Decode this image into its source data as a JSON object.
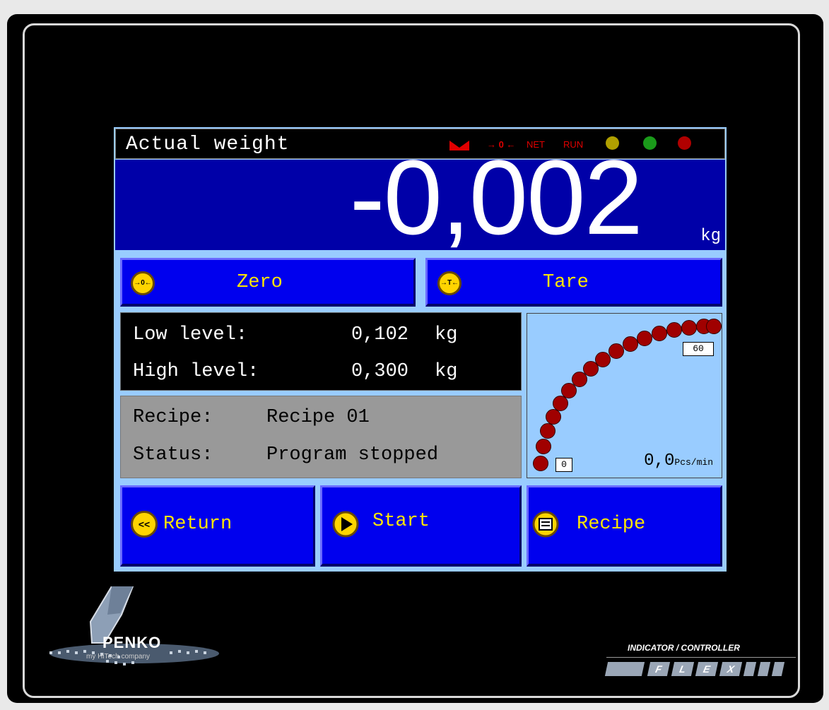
{
  "header": {
    "title": "Actual weight",
    "indicators": {
      "zero": "→ 0 ←",
      "net": "NET",
      "run": "RUN"
    },
    "led_colors": [
      "#b0a000",
      "#1a9a1a",
      "#b00000"
    ]
  },
  "weight": {
    "value": "-0,002",
    "unit": "kg"
  },
  "buttons": {
    "zero": {
      "label": "Zero",
      "icon": "→0←"
    },
    "tare": {
      "label": "Tare",
      "icon": "→T←"
    },
    "return": {
      "label": "Return",
      "icon": "<<"
    },
    "start": {
      "label": "Start"
    },
    "recipe": {
      "label": "Recipe"
    }
  },
  "levels": {
    "low_label": "Low level:",
    "low_value": "0,102",
    "low_unit": "kg",
    "high_label": "High level:",
    "high_value": "0,300",
    "high_unit": "kg"
  },
  "program": {
    "recipe_label": "Recipe:",
    "recipe_value": "Recipe 01",
    "status_label": "Status:",
    "status_value": "Program stopped"
  },
  "gauge": {
    "min": "0",
    "max": "60",
    "rate_value": "0,0",
    "rate_unit": "Pcs/min"
  },
  "branding": {
    "logo_text": "PENKO",
    "tagline": "my HiTech company",
    "product_title": "INDICATOR / CONTROLLER",
    "product_letters": [
      "F",
      "L",
      "E",
      "X"
    ]
  },
  "colors": {
    "display_blue": "#0000a8",
    "button_blue": "#0000ee",
    "button_text": "#ffe600",
    "screen_bg": "#99ccff",
    "alarm_red": "#e00000"
  }
}
